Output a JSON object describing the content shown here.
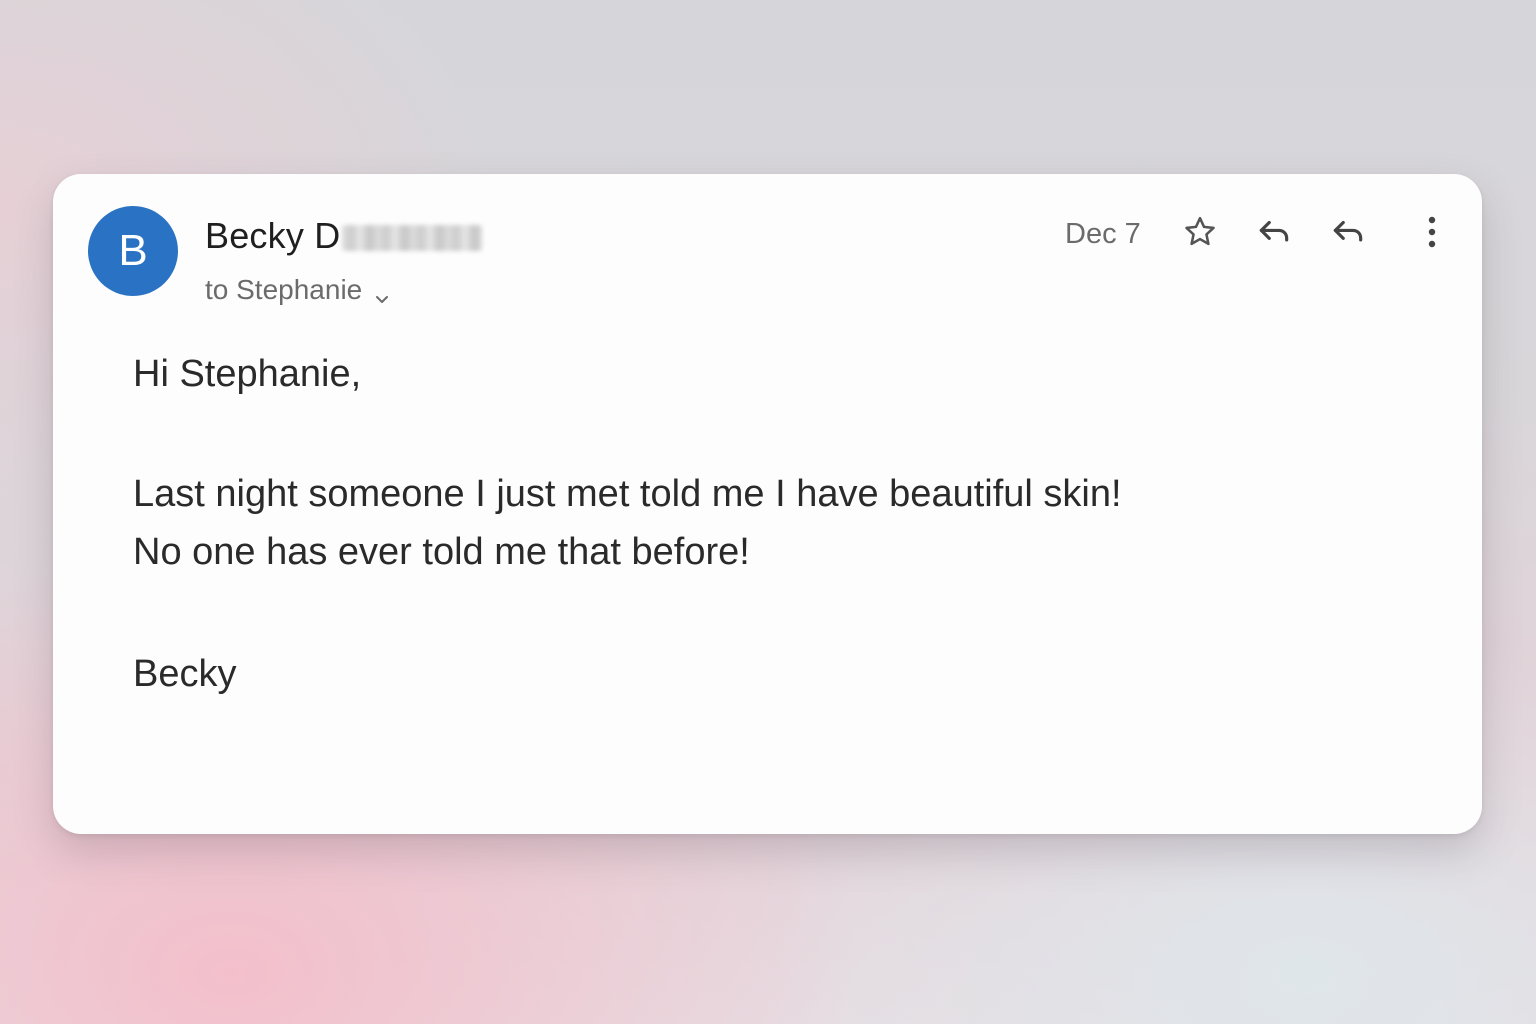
{
  "email": {
    "sender": {
      "avatar_initial": "B",
      "name_visible": "Becky D",
      "name_redacted": true
    },
    "recipient_label": "to Stephanie",
    "date": "Dec 7",
    "actions": {
      "star_icon": "star-outline-icon",
      "reply_icon": "reply-icon",
      "reply_all_icon": "reply-icon",
      "more_icon": "more-vert-icon"
    },
    "body": {
      "greeting": "Hi Stephanie,",
      "line1": "Last night someone I just met told me I have beautiful skin!",
      "line2": "No one has ever told me that before!",
      "signature": "Becky"
    }
  },
  "colors": {
    "avatar_bg": "#2a73c4",
    "text_primary": "#1f1f1f",
    "text_secondary": "#6b6b6b",
    "card_bg": "#fdfdfd"
  }
}
